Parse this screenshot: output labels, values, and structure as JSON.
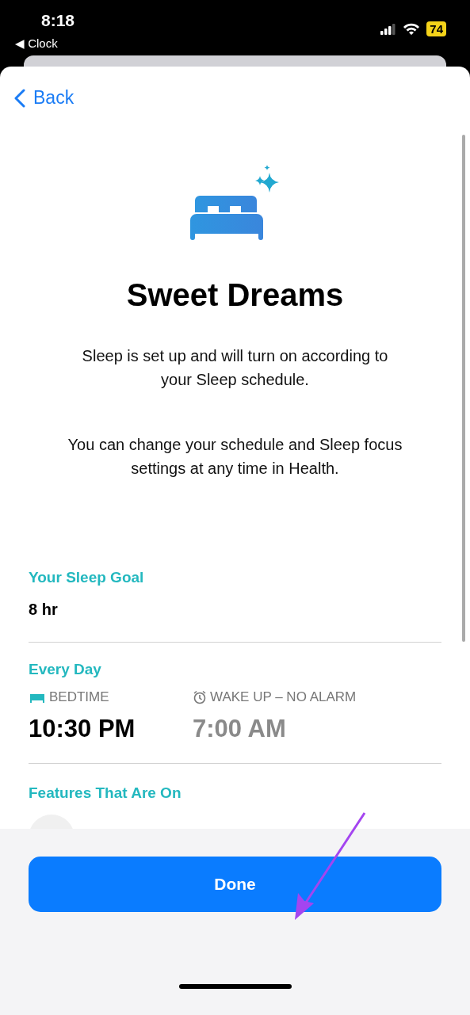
{
  "status_bar": {
    "time": "8:18",
    "back_app": "◀ Clock",
    "battery": "74"
  },
  "nav": {
    "back": "Back"
  },
  "title": "Sweet Dreams",
  "paragraphs": [
    "Sleep is set up and will turn on according to your Sleep schedule.",
    "You can change your schedule and Sleep focus settings at any time in Health."
  ],
  "goal": {
    "label": "Your Sleep Goal",
    "value": "8 hr"
  },
  "schedule": {
    "label": "Every Day",
    "bedtime": {
      "label": "BEDTIME",
      "time": "10:30 PM"
    },
    "wake": {
      "label": "WAKE UP – NO ALARM",
      "time": "7:00 AM",
      "alarm_on": false
    }
  },
  "features": {
    "label": "Features That Are On"
  },
  "done": "Done"
}
